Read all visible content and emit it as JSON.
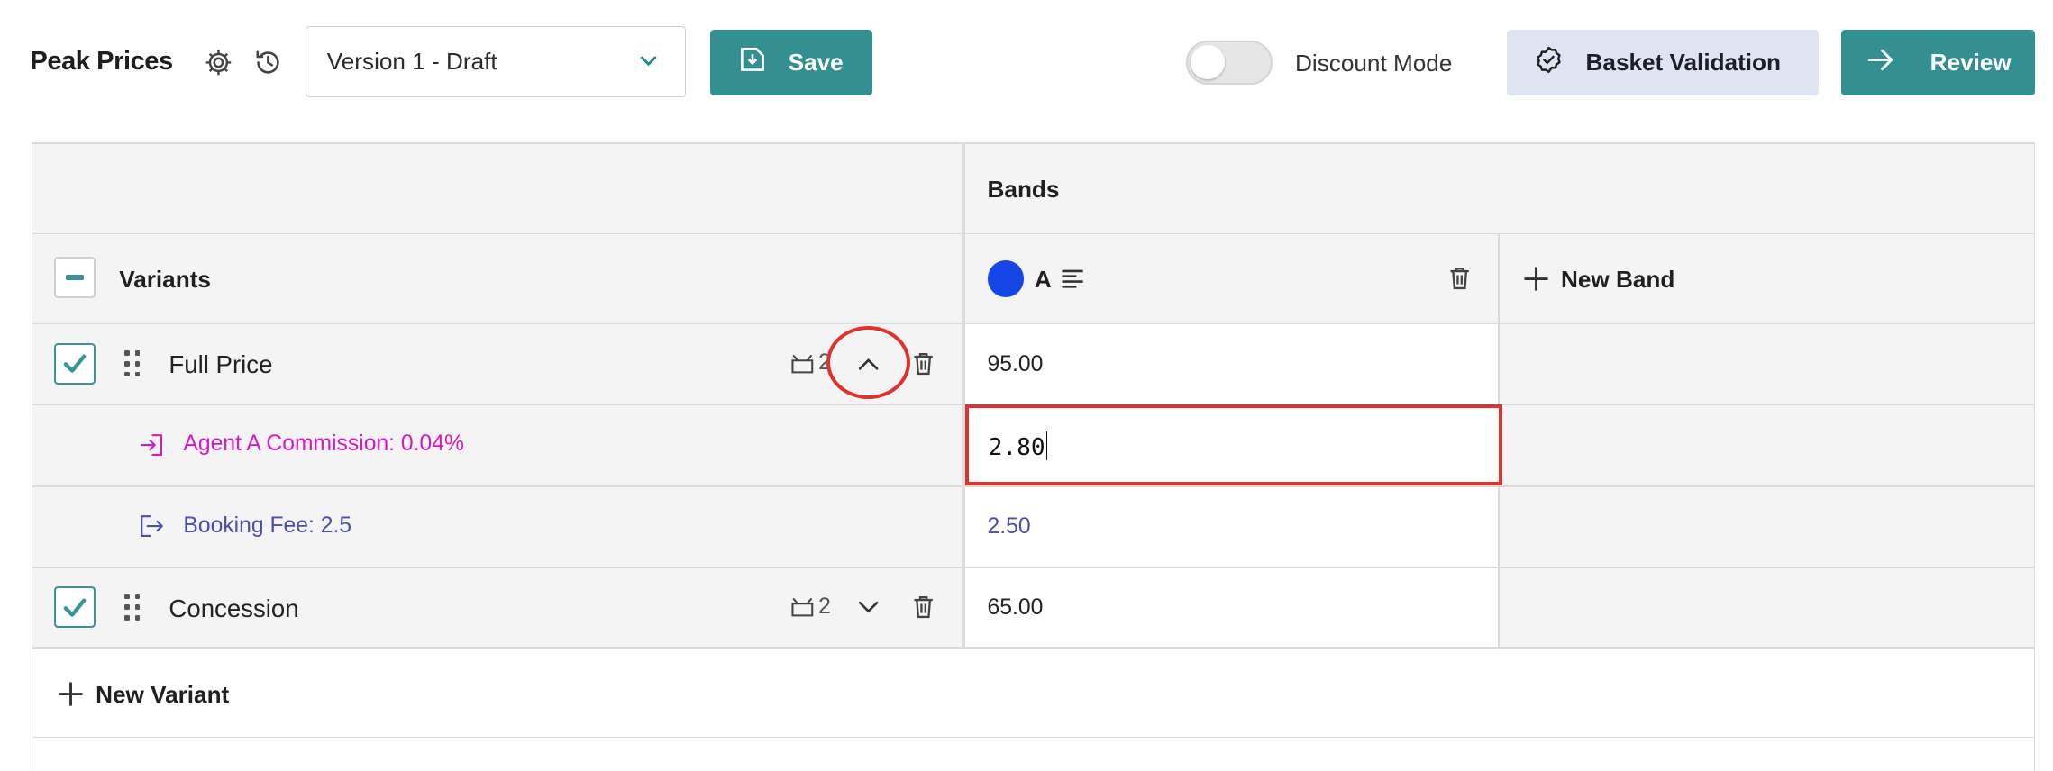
{
  "header": {
    "title": "Peak Prices",
    "version_select": {
      "value": "Version 1 - Draft"
    },
    "save_label": "Save",
    "discount_mode": {
      "label": "Discount Mode",
      "enabled": false
    },
    "basket_validation_label": "Basket Validation",
    "review_label": "Review",
    "icons": [
      "gear-icon",
      "history-icon",
      "chevron-down-icon",
      "save-icon",
      "badge-check-icon",
      "arrow-right-icon"
    ]
  },
  "table": {
    "bands_header": "Bands",
    "variants_header": "Variants",
    "band": {
      "name": "A",
      "color": "#1447e6"
    },
    "new_band_label": "New Band",
    "new_variant_label": "New Variant",
    "variants": [
      {
        "name": "Full Price",
        "checked": true,
        "ticket_count": "2",
        "expanded": true,
        "price": "95.00",
        "fees": [
          {
            "label": "Agent A Commission: 0.04%",
            "value": "2.80",
            "type": "commission",
            "color": "#d21bc8",
            "editing": true
          },
          {
            "label": "Booking Fee: 2.5",
            "value": "2.50",
            "type": "booking-fee",
            "color": "#4a4fa8"
          }
        ]
      },
      {
        "name": "Concession",
        "checked": true,
        "ticket_count": "2",
        "expanded": false,
        "price": "65.00"
      }
    ]
  },
  "colors": {
    "accent": "#348f90",
    "basket_button_bg": "#dfe4f2",
    "highlight_red": "#e0322d"
  }
}
